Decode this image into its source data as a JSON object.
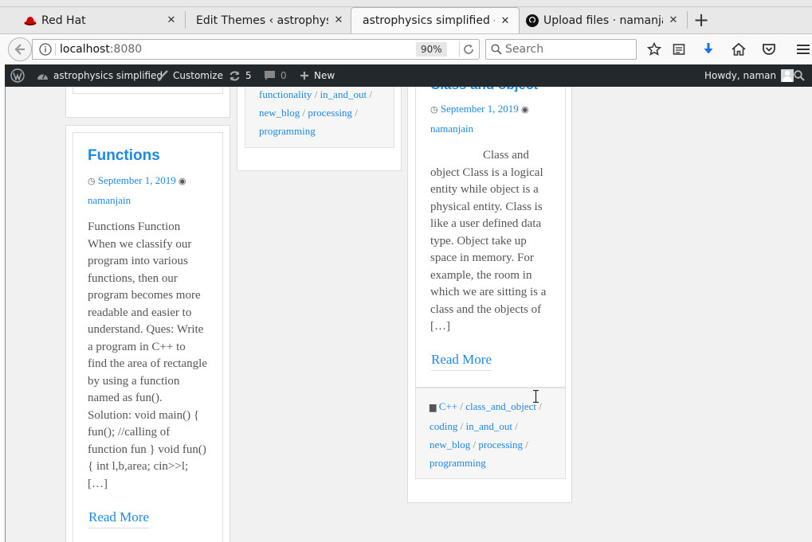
{
  "browser": {
    "tabs": [
      {
        "label": "Red Hat",
        "favicon": "redhat-icon"
      },
      {
        "label": "Edit Themes ‹ astrophysic…",
        "favicon": "none"
      },
      {
        "label": "astrophysics simplified – …",
        "favicon": "none",
        "active": true
      },
      {
        "label": "Upload files · namanja…",
        "favicon": "github-icon"
      }
    ],
    "url_host": "localhost",
    "url_port": ":8080",
    "zoom": "90%",
    "search_placeholder": "Search"
  },
  "adminbar": {
    "site_name": "astrophysics simplified",
    "customize": "Customize",
    "updates_count": "5",
    "comments_count": "0",
    "new_label": "New",
    "howdy": "Howdy, naman"
  },
  "posts": {
    "left": {
      "title": "Functions",
      "date": "September 1, 2019",
      "author": "namanjain",
      "excerpt": "Functions Function When we classify our program into various functions, then our program becomes more readable and easier to understand. Ques: Write a program in C++ to find the area of rectangle by using a function named as fun(). Solution: void main() { fun(); //calling of function fun } void fun() { int l,b,area; cin>>l; […]",
      "read_more": "Read More"
    },
    "middle": {
      "tags": [
        "functionality",
        "in_and_out",
        "new_blog",
        "processing",
        "programming"
      ]
    },
    "right": {
      "title": "Class and object",
      "date": "September 1, 2019",
      "author": "namanjain",
      "excerpt": "Class and object Class is a logical entity while object is a physical entity. Class is like a user defined data type. Object take up space in memory. For example, the room in which we are sitting is a class and the objects of […]",
      "read_more": "Read More",
      "tags": [
        "C++",
        "class_and_object",
        "coding",
        "in_and_out",
        "new_blog",
        "processing",
        "programming"
      ]
    }
  },
  "colors": {
    "link": "#1e88e5",
    "adminbar_bg": "#23282d",
    "page_bg": "#f1f1f1"
  }
}
